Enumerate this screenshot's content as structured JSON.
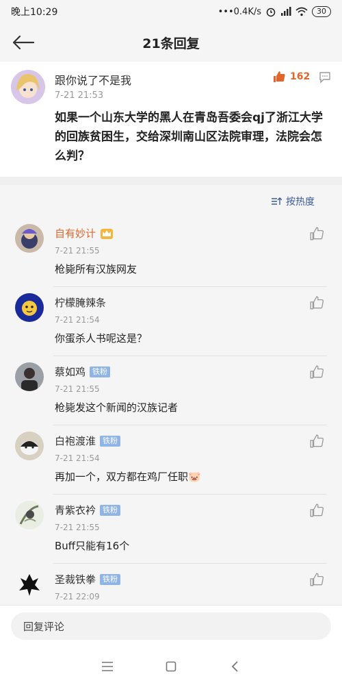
{
  "status": {
    "time": "晚上10:29",
    "network_speed": "0.4K/s",
    "battery": "30"
  },
  "header": {
    "title": "21条回复"
  },
  "post": {
    "author": "跟你说了不是我",
    "time": "7-21 21:53",
    "like_count": "162",
    "body": "如果一个山东大学的黑人在青岛吾委会qj了浙江大学的回族贫困生，交给深圳南山区法院审理，法院会怎么判？"
  },
  "sort": {
    "label": "按热度"
  },
  "replies": [
    {
      "name": "自有妙计",
      "time": "7-21 21:55",
      "text": "枪毙所有汉族网友"
    },
    {
      "name": "柠檬腌辣条",
      "time": "7-21 21:54",
      "text": "你蛋杀人书呢这是？"
    },
    {
      "name": "蔡如鸡",
      "badge": "铁粉",
      "time": "7-21 21:55",
      "text": "枪毙发这个新闻的汉族记者"
    },
    {
      "name": "白袍渡淮",
      "badge": "铁粉",
      "time": "7-21 21:54",
      "text": "再加一个，双方都在鸡厂任职🐷"
    },
    {
      "name": "青紫衣衿",
      "badge": "铁粉",
      "time": "7-21 21:55",
      "text": "Buff只能有16个"
    },
    {
      "name": "圣裁铁拳",
      "badge": "铁粉",
      "time": "7-21 22:09",
      "text": ""
    }
  ],
  "reply_box": {
    "placeholder": "回复评论"
  },
  "colors": {
    "accent_orange": "#e0662a",
    "link_blue": "#3b5b9c",
    "badge_blue": "#8fb4e6"
  }
}
